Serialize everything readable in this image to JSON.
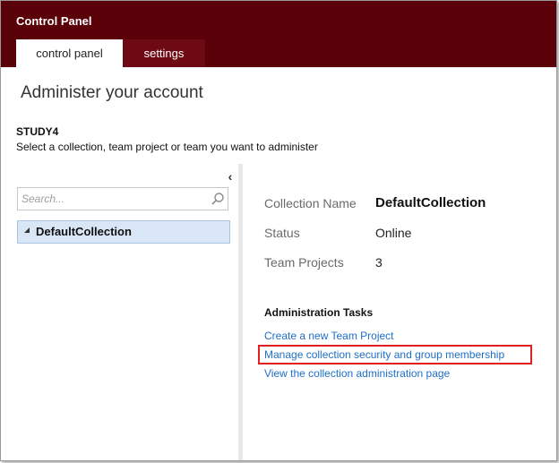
{
  "header": {
    "title": "Control Panel",
    "tabs": [
      {
        "label": "control panel",
        "active": true
      },
      {
        "label": "settings",
        "active": false
      }
    ]
  },
  "page": {
    "heading": "Administer your account",
    "account_name": "STUDY4",
    "instruction": "Select a collection, team project or team you want to administer"
  },
  "sidebar": {
    "collapse_glyph": "‹",
    "search_placeholder": "Search...",
    "tree": [
      {
        "label": "DefaultCollection",
        "expanded": true,
        "selected": true
      }
    ]
  },
  "details": {
    "rows": [
      {
        "label": "Collection Name",
        "value": "DefaultCollection"
      },
      {
        "label": "Status",
        "value": "Online"
      },
      {
        "label": "Team Projects",
        "value": "3"
      }
    ]
  },
  "tasks": {
    "heading": "Administration Tasks",
    "links": [
      {
        "label": "Create a new Team Project"
      },
      {
        "label": "Manage collection security and group membership",
        "highlighted": true
      },
      {
        "label": "View the collection administration page"
      }
    ]
  },
  "colors": {
    "header_bg": "#5a0009",
    "link": "#1e6fc8",
    "highlight": "#e02020",
    "selected_bg": "#d8e6f5"
  }
}
